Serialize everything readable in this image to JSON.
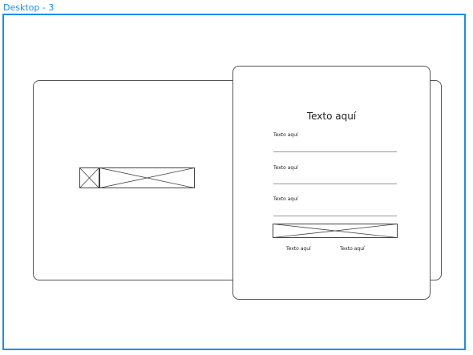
{
  "frame": {
    "label": "Desktop - 3",
    "accent": "#1a8ef0"
  },
  "left_panel": {
    "image_placeholder": "image-placeholder"
  },
  "form": {
    "title": "Texto aquí",
    "fields": [
      {
        "label": "Texto aquí"
      },
      {
        "label": "Texto aquí"
      },
      {
        "label": "Texto aquí"
      }
    ],
    "button_placeholder": "button-placeholder",
    "links": [
      "Texto aquí",
      "Texto aquí"
    ]
  }
}
